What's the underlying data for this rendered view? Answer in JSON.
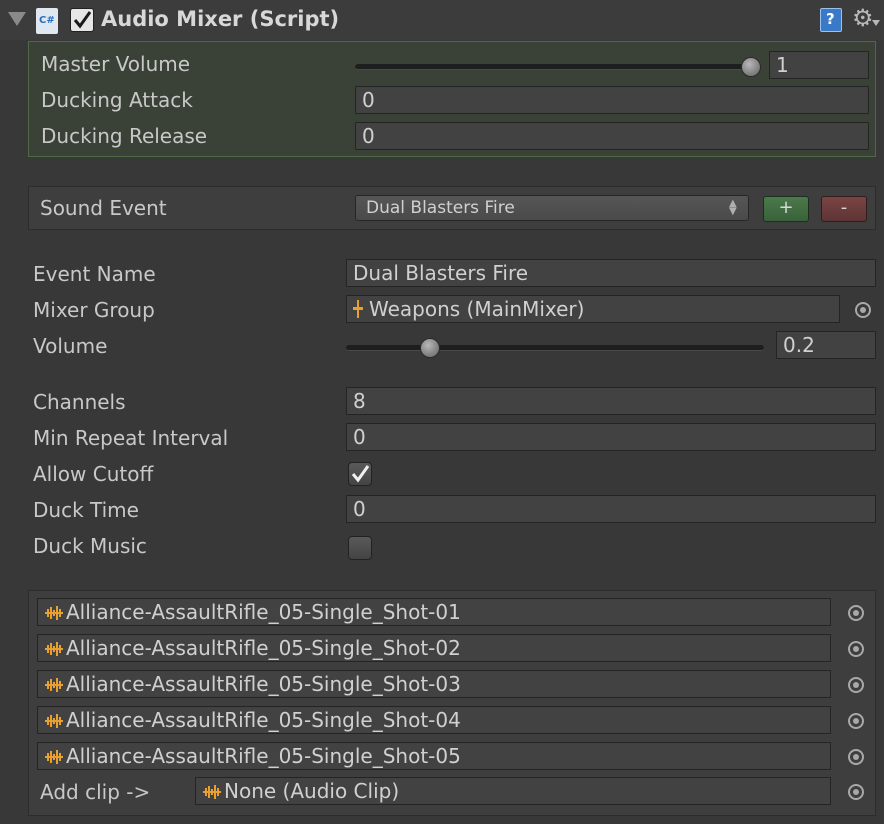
{
  "header": {
    "title": "Audio Mixer (Script)",
    "enabled": true
  },
  "master": {
    "master_volume_label": "Master Volume",
    "master_volume_value": "1",
    "master_volume_fraction": 1.0,
    "ducking_attack_label": "Ducking Attack",
    "ducking_attack_value": "0",
    "ducking_release_label": "Ducking Release",
    "ducking_release_value": "0"
  },
  "sound_event": {
    "label": "Sound Event",
    "selected": "Dual Blasters Fire",
    "add_label": "+",
    "remove_label": "-"
  },
  "event": {
    "event_name_label": "Event Name",
    "event_name_value": "Dual Blasters Fire",
    "mixer_group_label": "Mixer Group",
    "mixer_group_value": "Weapons (MainMixer)",
    "volume_label": "Volume",
    "volume_value": "0.2",
    "volume_fraction": 0.2,
    "channels_label": "Channels",
    "channels_value": "8",
    "min_repeat_label": "Min Repeat Interval",
    "min_repeat_value": "0",
    "allow_cutoff_label": "Allow Cutoff",
    "allow_cutoff_checked": true,
    "duck_time_label": "Duck Time",
    "duck_time_value": "0",
    "duck_music_label": "Duck Music",
    "duck_music_checked": false
  },
  "clips": {
    "items": [
      "Alliance-AssaultRifle_05-Single_Shot-01",
      "Alliance-AssaultRifle_05-Single_Shot-02",
      "Alliance-AssaultRifle_05-Single_Shot-03",
      "Alliance-AssaultRifle_05-Single_Shot-04",
      "Alliance-AssaultRifle_05-Single_Shot-05"
    ],
    "add_label": "Add clip ->",
    "add_value": "None (Audio Clip)"
  },
  "colors": {
    "panel_bg": "#383838",
    "master_section_bg": "#3a4238",
    "master_section_border": "#4d6a45",
    "add_button": "#3e6b3e",
    "remove_button": "#6b3a3a",
    "clip_icon": "#e8a030"
  }
}
